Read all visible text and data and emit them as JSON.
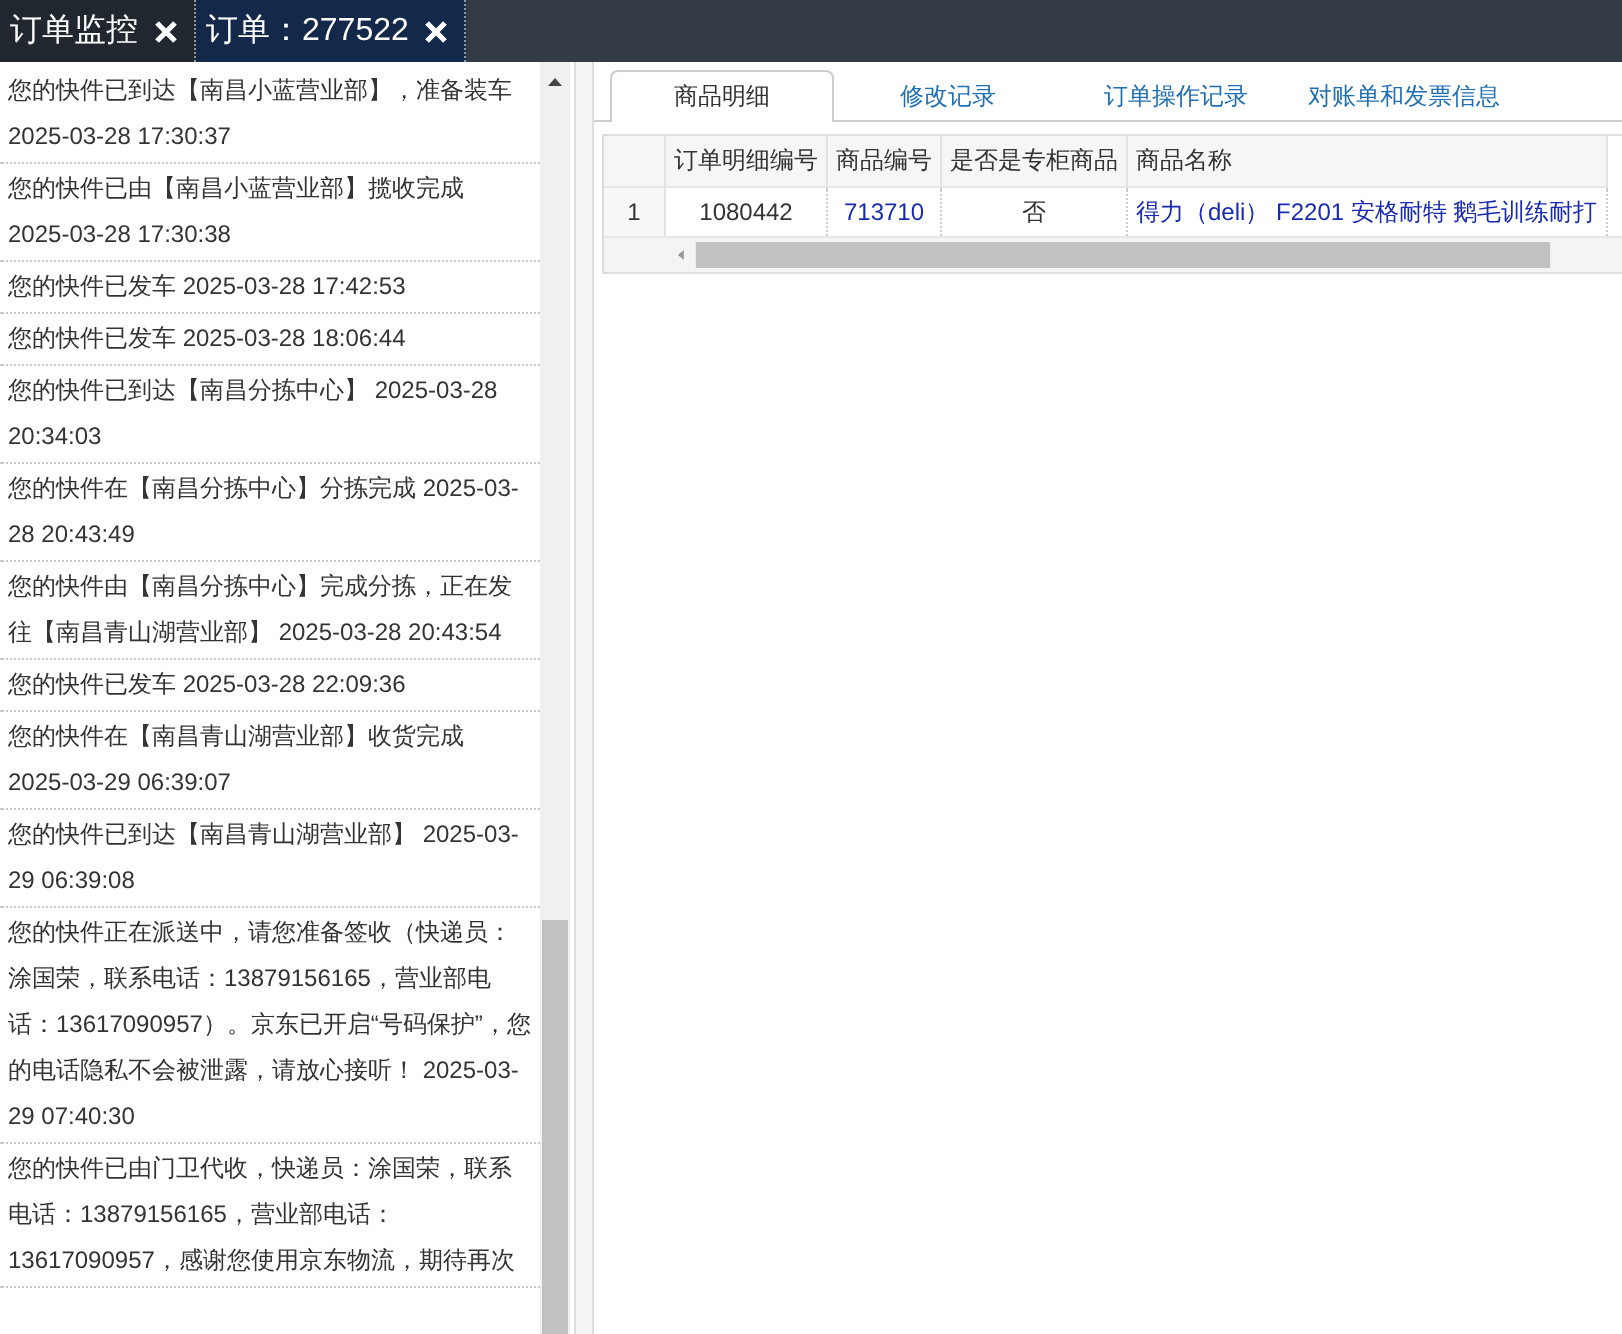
{
  "tabs": [
    {
      "label": "订单监控",
      "selected": false
    },
    {
      "label": "订单：277522",
      "selected": true
    }
  ],
  "tracking": [
    "您的快件已到达【南昌小蓝营业部】，准备装车 2025-03-28 17:30:37",
    "您的快件已由【南昌小蓝营业部】揽收完成 2025-03-28 17:30:38",
    "您的快件已发车 2025-03-28 17:42:53",
    "您的快件已发车 2025-03-28 18:06:44",
    "您的快件已到达【南昌分拣中心】 2025-03-28 20:34:03",
    "您的快件在【南昌分拣中心】分拣完成 2025-03-28 20:43:49",
    "您的快件由【南昌分拣中心】完成分拣，正在发往【南昌青山湖营业部】 2025-03-28 20:43:54",
    "您的快件已发车 2025-03-28 22:09:36",
    "您的快件在【南昌青山湖营业部】收货完成 2025-03-29 06:39:07",
    "您的快件已到达【南昌青山湖营业部】 2025-03-29 06:39:08",
    "您的快件正在派送中，请您准备签收（快递员：涂国荣，联系电话：13879156165，营业部电话：13617090957）。京东已开启“号码保护”，您的电话隐私不会被泄露，请放心接听！ 2025-03-29 07:40:30",
    "您的快件已由门卫代收，快递员：涂国荣，联系电话：13879156165，营业部电话：13617090957，感谢您使用京东物流，期待再次"
  ],
  "detail_tabs": [
    {
      "label": "商品明细",
      "selected": true
    },
    {
      "label": "修改记录",
      "selected": false
    },
    {
      "label": "订单操作记录",
      "selected": false
    },
    {
      "label": "对账单和发票信息",
      "selected": false
    }
  ],
  "table": {
    "columns": [
      "订单明细编号",
      "商品编号",
      "是否是专柜商品",
      "商品名称"
    ],
    "rows": [
      {
        "number": "1",
        "cells": [
          {
            "text": "1080442",
            "kind": "plain"
          },
          {
            "text": "713710",
            "kind": "link"
          },
          {
            "text": "否",
            "kind": "plain"
          },
          {
            "text": "得力（deli） F2201 安格耐特 鹅毛训练耐打",
            "kind": "link"
          }
        ]
      }
    ]
  }
}
